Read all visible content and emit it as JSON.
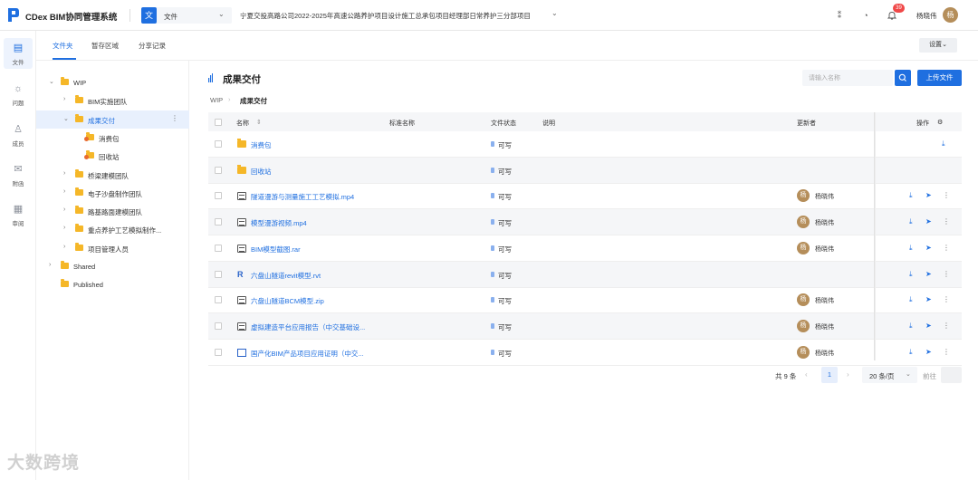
{
  "app": {
    "title": "CDex BIM协同管理系统",
    "workspace_badge": "文",
    "workspace_label": "文件",
    "project_name": "宁夏交投高路公司2022-2025年高速公路养护项目设计施工总承包项目经理部日常养护三分部项目",
    "notification_count": "39",
    "user_name": "杨晓伟",
    "user_avatar": "杨"
  },
  "rail": [
    {
      "label": "文件",
      "icon": "files-icon",
      "glyph": "▤",
      "active": true
    },
    {
      "label": "问题",
      "icon": "bug-icon",
      "glyph": "☼",
      "active": false
    },
    {
      "label": "成员",
      "icon": "members-icon",
      "glyph": "♙",
      "active": false
    },
    {
      "label": "附函",
      "icon": "mail-icon",
      "glyph": "✉",
      "active": false
    },
    {
      "label": "审阅",
      "icon": "calendar-icon",
      "glyph": "▦",
      "active": false
    }
  ],
  "tabs": [
    {
      "label": "文件夹",
      "active": true
    },
    {
      "label": "暂存区域",
      "active": false
    },
    {
      "label": "分享记录",
      "active": false
    }
  ],
  "settings_label": "设置",
  "tree": [
    {
      "label": "WIP",
      "depth": 0,
      "chevron": "⌄",
      "selected": false
    },
    {
      "label": "BIM实施团队",
      "depth": 1,
      "chevron": "›",
      "selected": false
    },
    {
      "label": "成果交付",
      "depth": 1,
      "chevron": "⌄",
      "selected": true
    },
    {
      "label": "消费包",
      "depth": 2,
      "chevron": "",
      "special": true,
      "selected": false
    },
    {
      "label": "回收站",
      "depth": 2,
      "chevron": "",
      "special": true,
      "selected": false
    },
    {
      "label": "桥梁建模团队",
      "depth": 1,
      "chevron": "›",
      "selected": false
    },
    {
      "label": "电子沙盘制作团队",
      "depth": 1,
      "chevron": "›",
      "selected": false
    },
    {
      "label": "路基路面建模团队",
      "depth": 1,
      "chevron": "›",
      "selected": false
    },
    {
      "label": "重点养护工艺模拟制作...",
      "depth": 1,
      "chevron": "›",
      "selected": false
    },
    {
      "label": "项目管理人员",
      "depth": 1,
      "chevron": "›",
      "selected": false
    },
    {
      "label": "Shared",
      "depth": 0,
      "chevron": "›",
      "selected": false
    },
    {
      "label": "Published",
      "depth": 0,
      "chevron": "",
      "selected": false
    }
  ],
  "main": {
    "title": "成果交付",
    "search_placeholder": "请输入名称",
    "upload_label": "上传文件",
    "breadcrumb": [
      "WIP",
      "成果交付"
    ],
    "columns": {
      "name": "名称",
      "standard_name": "标准名称",
      "file_status": "文件状态",
      "description": "说明",
      "updater": "更新者",
      "actions": "操作"
    },
    "rows": [
      {
        "name": "消费包",
        "type": "folder",
        "status": "可写",
        "updater": "",
        "actions": "download"
      },
      {
        "name": "回收站",
        "type": "folder",
        "status": "可写",
        "updater": "",
        "actions": "none"
      },
      {
        "name": "隧道漫游与测量施工工艺模拟.mp4",
        "type": "doc",
        "status": "可写",
        "updater": "杨晓伟",
        "actions": "all"
      },
      {
        "name": "模型漫游视频.mp4",
        "type": "doc",
        "status": "可写",
        "updater": "杨晓伟",
        "actions": "all"
      },
      {
        "name": "BIM模型截图.rar",
        "type": "doc",
        "status": "可写",
        "updater": "杨晓伟",
        "actions": "all"
      },
      {
        "name": "六盘山隧道revit模型.rvt",
        "type": "rvt",
        "status": "可写",
        "updater": "",
        "actions": "all"
      },
      {
        "name": "六盘山隧道BCM模型.zip",
        "type": "doc",
        "status": "可写",
        "updater": "杨晓伟",
        "actions": "all"
      },
      {
        "name": "虚拟建造平台应用报告（中交基础设...",
        "type": "doc",
        "status": "可写",
        "updater": "杨晓伟",
        "actions": "all"
      },
      {
        "name": "国产化BIM产品项目应用证明（中交...",
        "type": "img",
        "status": "可写",
        "updater": "杨晓伟",
        "actions": "all"
      }
    ]
  },
  "pagination": {
    "total": "共 9 条",
    "current_page": "1",
    "page_size": "20 条/页",
    "goto_label": "前往"
  },
  "watermark": "大数跨境",
  "colors": {
    "primary": "#1f6fe0",
    "folder": "#f5b728",
    "avatar": "#b58e5a",
    "badge": "#f04848"
  }
}
